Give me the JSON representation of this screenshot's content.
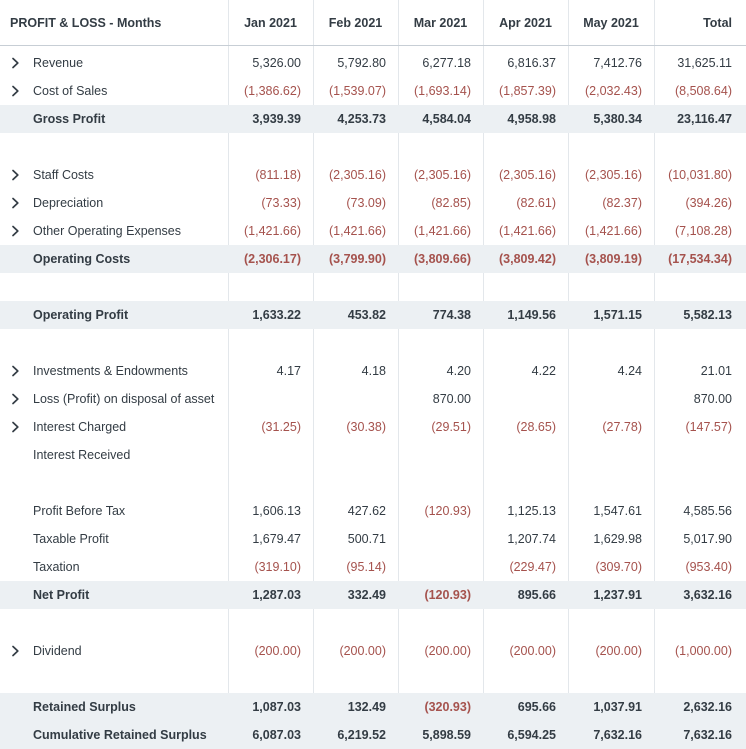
{
  "table": {
    "title": "PROFIT & LOSS - Months",
    "columns": [
      "Jan 2021",
      "Feb 2021",
      "Mar 2021",
      "Apr 2021",
      "May 2021",
      "Total"
    ],
    "rows": [
      {
        "label": "Revenue",
        "expandable": true,
        "subtotal": false,
        "values": [
          "5,326.00",
          "5,792.80",
          "6,277.18",
          "6,816.37",
          "7,412.76",
          "31,625.11"
        ]
      },
      {
        "label": "Cost of Sales",
        "expandable": true,
        "subtotal": false,
        "values": [
          "(1,386.62)",
          "(1,539.07)",
          "(1,693.14)",
          "(1,857.39)",
          "(2,032.43)",
          "(8,508.64)"
        ]
      },
      {
        "label": "Gross Profit",
        "expandable": false,
        "subtotal": true,
        "values": [
          "3,939.39",
          "4,253.73",
          "4,584.04",
          "4,958.98",
          "5,380.34",
          "23,116.47"
        ]
      },
      {
        "label": "Staff Costs",
        "expandable": true,
        "subtotal": false,
        "values": [
          "(811.18)",
          "(2,305.16)",
          "(2,305.16)",
          "(2,305.16)",
          "(2,305.16)",
          "(10,031.80)"
        ]
      },
      {
        "label": "Depreciation",
        "expandable": true,
        "subtotal": false,
        "values": [
          "(73.33)",
          "(73.09)",
          "(82.85)",
          "(82.61)",
          "(82.37)",
          "(394.26)"
        ]
      },
      {
        "label": "Other Operating Expenses",
        "expandable": true,
        "subtotal": false,
        "values": [
          "(1,421.66)",
          "(1,421.66)",
          "(1,421.66)",
          "(1,421.66)",
          "(1,421.66)",
          "(7,108.28)"
        ]
      },
      {
        "label": "Operating Costs",
        "expandable": false,
        "subtotal": true,
        "values": [
          "(2,306.17)",
          "(3,799.90)",
          "(3,809.66)",
          "(3,809.42)",
          "(3,809.19)",
          "(17,534.34)"
        ]
      },
      {
        "label": "Operating Profit",
        "expandable": false,
        "subtotal": true,
        "values": [
          "1,633.22",
          "453.82",
          "774.38",
          "1,149.56",
          "1,571.15",
          "5,582.13"
        ]
      },
      {
        "label": "Investments & Endowments",
        "expandable": true,
        "subtotal": false,
        "values": [
          "4.17",
          "4.18",
          "4.20",
          "4.22",
          "4.24",
          "21.01"
        ]
      },
      {
        "label": "Loss (Profit) on disposal of asset",
        "expandable": true,
        "subtotal": false,
        "values": [
          "",
          "",
          "870.00",
          "",
          "",
          "870.00"
        ]
      },
      {
        "label": "Interest Charged",
        "expandable": true,
        "subtotal": false,
        "values": [
          "(31.25)",
          "(30.38)",
          "(29.51)",
          "(28.65)",
          "(27.78)",
          "(147.57)"
        ]
      },
      {
        "label": "Interest Received",
        "expandable": false,
        "subtotal": false,
        "values": [
          "",
          "",
          "",
          "",
          "",
          ""
        ]
      },
      {
        "label": "Profit Before Tax",
        "expandable": false,
        "subtotal": false,
        "values": [
          "1,606.13",
          "427.62",
          "(120.93)",
          "1,125.13",
          "1,547.61",
          "4,585.56"
        ]
      },
      {
        "label": "Taxable Profit",
        "expandable": false,
        "subtotal": false,
        "values": [
          "1,679.47",
          "500.71",
          "",
          "1,207.74",
          "1,629.98",
          "5,017.90"
        ]
      },
      {
        "label": "Taxation",
        "expandable": false,
        "subtotal": false,
        "values": [
          "(319.10)",
          "(95.14)",
          "",
          "(229.47)",
          "(309.70)",
          "(953.40)"
        ]
      },
      {
        "label": "Net Profit",
        "expandable": false,
        "subtotal": true,
        "values": [
          "1,287.03",
          "332.49",
          "(120.93)",
          "895.66",
          "1,237.91",
          "3,632.16"
        ]
      },
      {
        "label": "Dividend",
        "expandable": true,
        "subtotal": false,
        "values": [
          "(200.00)",
          "(200.00)",
          "(200.00)",
          "(200.00)",
          "(200.00)",
          "(1,000.00)"
        ]
      },
      {
        "label": "Retained Surplus",
        "expandable": false,
        "subtotal": true,
        "values": [
          "1,087.03",
          "132.49",
          "(320.93)",
          "695.66",
          "1,037.91",
          "2,632.16"
        ]
      },
      {
        "label": "Cumulative Retained Surplus",
        "expandable": false,
        "subtotal": true,
        "values": [
          "6,087.03",
          "6,219.52",
          "5,898.59",
          "6,594.25",
          "7,632.16",
          "7,632.16"
        ]
      }
    ]
  },
  "colors": {
    "subtotal_bg": "#ecf0f3",
    "negative_text": "#a5524d",
    "grid_line": "#e3e7eb"
  },
  "icons": {
    "expand": "chevron-right-icon"
  }
}
